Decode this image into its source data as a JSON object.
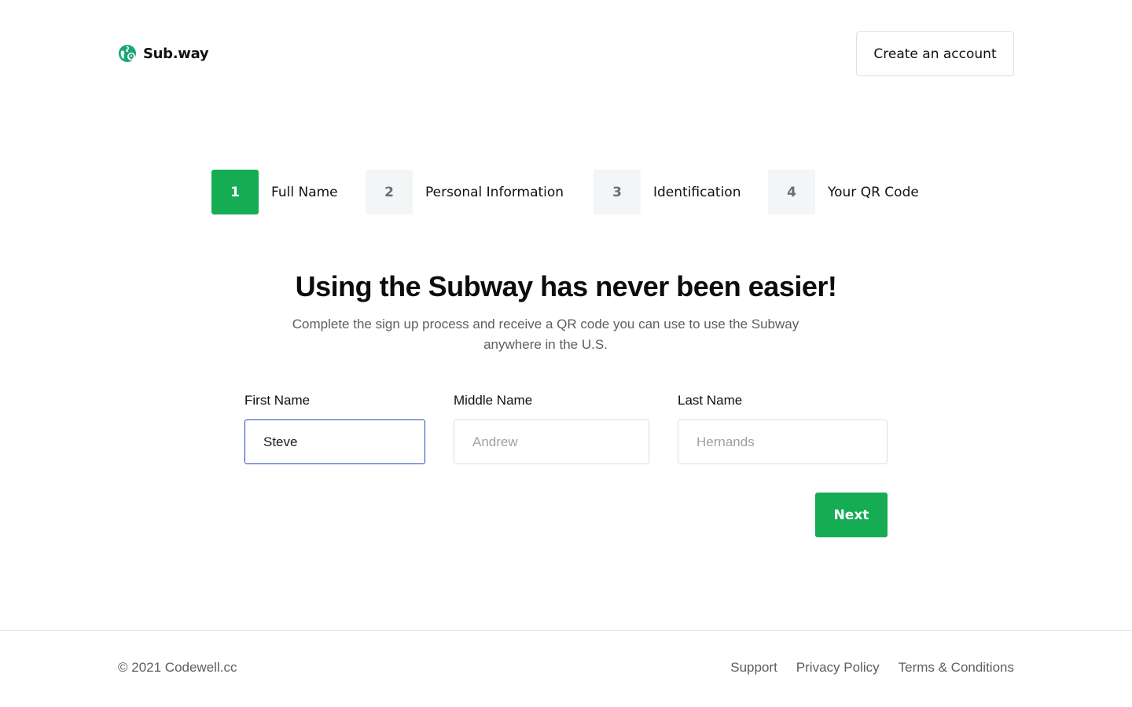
{
  "header": {
    "logo_text": "Sub.way",
    "logo_icon": "globe-pin-icon",
    "create_account_label": "Create an account"
  },
  "steps": [
    {
      "number": "1",
      "label": "Full Name",
      "active": true
    },
    {
      "number": "2",
      "label": "Personal Information",
      "active": false
    },
    {
      "number": "3",
      "label": "Identification",
      "active": false
    },
    {
      "number": "4",
      "label": "Your QR Code",
      "active": false
    }
  ],
  "main": {
    "title": "Using the Subway has never been easier!",
    "subtitle": "Complete the sign up process and receive a QR code you can use to use the Subway anywhere in the U.S."
  },
  "form": {
    "first_name": {
      "label": "First Name",
      "value": "Steve",
      "placeholder": ""
    },
    "middle_name": {
      "label": "Middle Name",
      "value": "",
      "placeholder": "Andrew"
    },
    "last_name": {
      "label": "Last Name",
      "value": "",
      "placeholder": "Hernands"
    },
    "next_label": "Next"
  },
  "footer": {
    "copyright": "© 2021 Codewell.cc",
    "links": [
      "Support",
      "Privacy Policy",
      "Terms & Conditions"
    ]
  },
  "colors": {
    "accent": "#15ac53",
    "focus_border": "#2747c8",
    "inactive_step_bg": "#f4f5f7"
  }
}
